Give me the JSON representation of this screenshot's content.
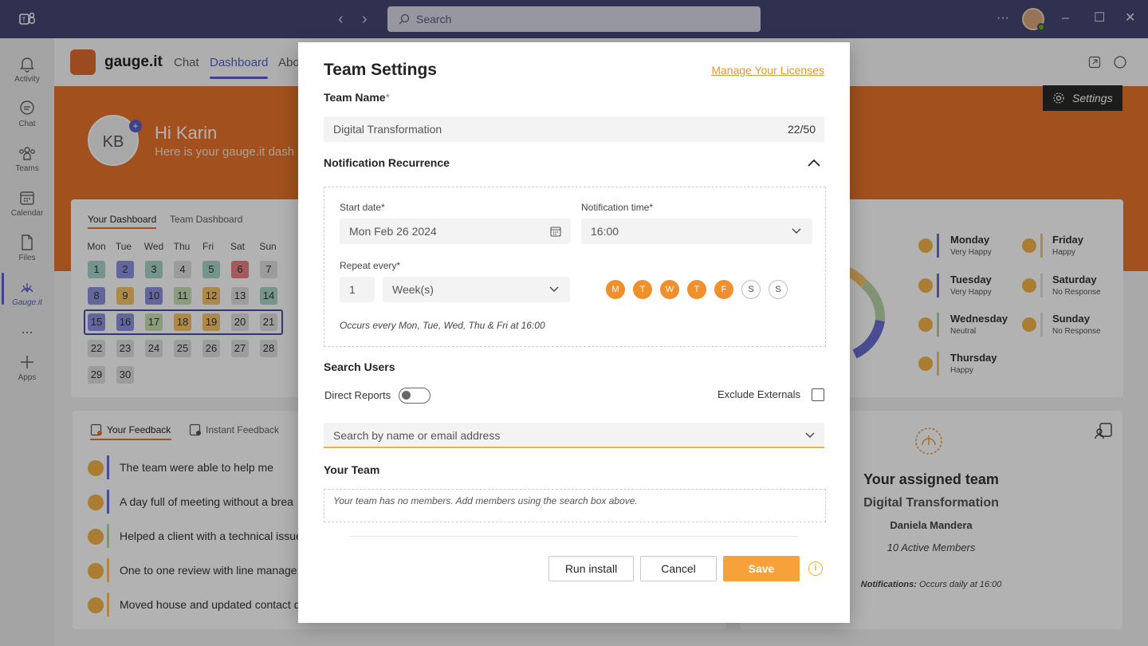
{
  "titlebar": {
    "search_placeholder": "Search",
    "back_icon": "chevron-left-icon",
    "forward_icon": "chevron-right-icon"
  },
  "rail": {
    "items": [
      {
        "label": "Activity",
        "icon": "bell-icon"
      },
      {
        "label": "Chat",
        "icon": "chat-icon"
      },
      {
        "label": "Teams",
        "icon": "teams-icon"
      },
      {
        "label": "Calendar",
        "icon": "calendar-icon"
      },
      {
        "label": "Files",
        "icon": "file-icon"
      },
      {
        "label": "Gauge.it",
        "icon": "gauge-icon"
      },
      {
        "label": "...",
        "icon": "more-icon"
      },
      {
        "label": "Apps",
        "icon": "plus-icon"
      }
    ]
  },
  "app": {
    "name": "gauge.it",
    "tabs": [
      "Chat",
      "Dashboard",
      "Abo"
    ],
    "active_tab": "Dashboard"
  },
  "banner": {
    "initials": "KB",
    "greeting": "Hi Karin",
    "subtitle": "Here is your gauge.it dash",
    "settings_label": "Settings"
  },
  "dashboard": {
    "tabs": [
      "Your Dashboard",
      "Team Dashboard"
    ],
    "weekdays": [
      "Mon",
      "Tue",
      "Wed",
      "Thu",
      "Fri",
      "Sat",
      "Sun"
    ],
    "days": [
      [
        "1",
        "2",
        "3",
        "4",
        "5",
        "6",
        "7"
      ],
      [
        "8",
        "9",
        "10",
        "11",
        "12",
        "13",
        "14"
      ],
      [
        "15",
        "16",
        "17",
        "18",
        "19",
        "20",
        "21"
      ],
      [
        "22",
        "23",
        "24",
        "25",
        "26",
        "27",
        "28"
      ],
      [
        "29",
        "30",
        "",
        "",
        "",
        "",
        ""
      ]
    ],
    "moods": [
      {
        "day": "Monday",
        "mood": "Very Happy"
      },
      {
        "day": "Tuesday",
        "mood": "Very Happy"
      },
      {
        "day": "Wednesday",
        "mood": "Neutral"
      },
      {
        "day": "Thursday",
        "mood": "Happy"
      },
      {
        "day": "Friday",
        "mood": "Happy"
      },
      {
        "day": "Saturday",
        "mood": "No Response"
      },
      {
        "day": "Sunday",
        "mood": "No Response"
      }
    ]
  },
  "feedback": {
    "tabs": [
      "Your Feedback",
      "Instant Feedback"
    ],
    "items": [
      "The team were able to help me",
      "A day full of meeting without a brea",
      "Helped a client with a technical issue",
      "One to one review with line manage",
      "Moved house and updated contact d"
    ]
  },
  "assigned": {
    "title": "Your assigned team",
    "team": "Digital Transformation",
    "owner": "Daniela Mandera",
    "members": "10 Active Members",
    "notif_label": "Notifications:",
    "notif_value": "Occurs daily at 16:00"
  },
  "modal": {
    "title": "Team Settings",
    "licenses_link": "Manage Your Licenses",
    "team_name_label": "Team Name",
    "required_mark": "*",
    "team_name_value": "Digital Transformation",
    "team_name_counter": "22/50",
    "recurrence_label": "Notification Recurrence",
    "start_date_label": "Start date*",
    "start_date_value": "Mon Feb 26 2024",
    "notif_time_label": "Notification time*",
    "notif_time_value": "16:00",
    "repeat_label": "Repeat every*",
    "repeat_count": "1",
    "repeat_unit": "Week(s)",
    "days": [
      {
        "letter": "M",
        "on": true
      },
      {
        "letter": "T",
        "on": true
      },
      {
        "letter": "W",
        "on": true
      },
      {
        "letter": "T",
        "on": true
      },
      {
        "letter": "F",
        "on": true
      },
      {
        "letter": "S",
        "on": false
      },
      {
        "letter": "S",
        "on": false
      }
    ],
    "occurs_text": "Occurs every Mon, Tue, Wed, Thu & Fri at 16:00",
    "search_users_label": "Search Users",
    "direct_reports_label": "Direct Reports",
    "direct_reports_on": false,
    "exclude_externals_label": "Exclude Externals",
    "exclude_externals_checked": false,
    "search_placeholder": "Search by name or email address",
    "your_team_label": "Your Team",
    "your_team_empty": "Your team has no members. Add members using the search box above.",
    "run_install_label": "Run install",
    "cancel_label": "Cancel",
    "save_label": "Save"
  },
  "colors": {
    "teams_purple": "#464775",
    "accent_orange": "#e8742c",
    "save_orange": "#f7a13a",
    "brand_indigo": "#5b5fc7"
  }
}
